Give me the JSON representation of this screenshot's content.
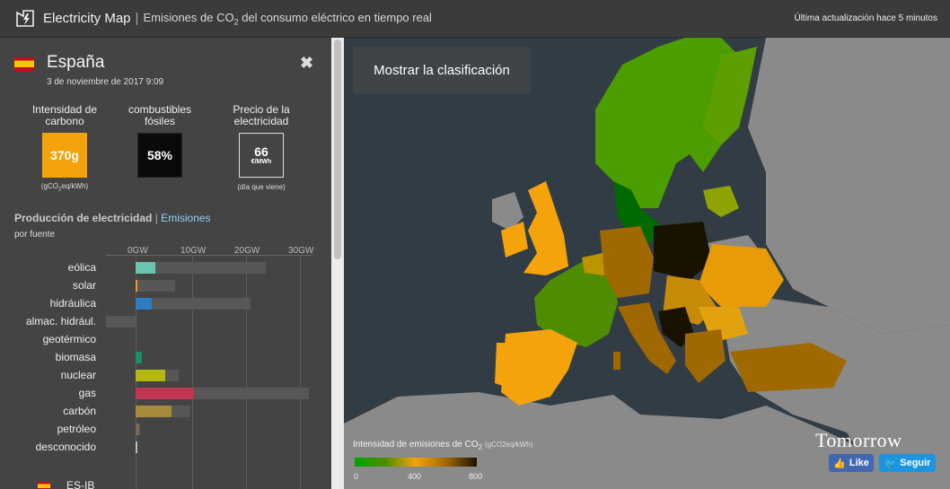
{
  "header": {
    "brand": "Electricity Map",
    "tagline_prefix": "Emisiones de CO",
    "tagline_sub": "2",
    "tagline_suffix": " del consumo eléctrico en tiempo real",
    "updated": "Última actualización hace 5 minutos"
  },
  "country": {
    "name": "España",
    "datetime": "3 de noviembre de 2017 9:09",
    "close_icon": "close-icon",
    "flag_icon": "spain-flag-icon"
  },
  "stats": {
    "carbon": {
      "label1": "Intensidad de",
      "label2": "carbono",
      "value": "370g",
      "unit": "(gCO2eq/kWh)",
      "color": "#f5a30b"
    },
    "fossil": {
      "label1": "combustibles",
      "label2": "fósiles",
      "value": "58%",
      "color": "#0a0a0a"
    },
    "price": {
      "label1": "Precio de la",
      "label2": "electricidad",
      "value": "66",
      "unit_small": "€/MWh",
      "note": "(día que viene)"
    }
  },
  "production": {
    "title": "Producción de electricidad",
    "separator": "|",
    "link": "Emisiones",
    "subtitle": "por fuente",
    "axis_ticks": [
      "0GW",
      "10GW",
      "20GW",
      "30GW"
    ],
    "rows": [
      {
        "label": "eólica",
        "production_gw": 3.7,
        "capacity_gw": 23.9,
        "color": "#6bc4b0"
      },
      {
        "label": "solar",
        "production_gw": 0.3,
        "capacity_gw": 7.2,
        "color": "#f59a1c"
      },
      {
        "label": "hidráulica",
        "production_gw": 3.0,
        "capacity_gw": 21.1,
        "color": "#2d7dc3"
      },
      {
        "label": "almac. hidrául.",
        "production_gw": 0,
        "capacity_gw": -5.5,
        "color": "#1f4e8c"
      },
      {
        "label": "geotérmico",
        "production_gw": 0,
        "capacity_gw": 0,
        "color": "#888888"
      },
      {
        "label": "biomasa",
        "production_gw": 1.1,
        "capacity_gw": 1.1,
        "color": "#1a8f6c"
      },
      {
        "label": "nuclear",
        "production_gw": 5.5,
        "capacity_gw": 7.9,
        "color": "#b5b80e"
      },
      {
        "label": "gas",
        "production_gw": 10.8,
        "capacity_gw": 31.9,
        "color": "#c0354f"
      },
      {
        "label": "carbón",
        "production_gw": 6.6,
        "capacity_gw": 10.1,
        "color": "#a88b3a"
      },
      {
        "label": "petróleo",
        "production_gw": 0.6,
        "capacity_gw": 0.9,
        "color": "#7a6a55"
      },
      {
        "label": "desconocido",
        "production_gw": 0.3,
        "capacity_gw": 0.4,
        "color": "#bbbbbb"
      }
    ]
  },
  "next_zone": {
    "label": "ES-IB",
    "flag_icon": "spain-flag-icon"
  },
  "map": {
    "ranking_button": "Mostrar la clasificación",
    "legend_title_prefix": "Intensidad de emisiones de CO",
    "legend_title_sub": "2",
    "legend_unit": "(gCO2eq/kWh)",
    "legend_ticks": [
      "0",
      "400",
      "800"
    ],
    "tomorrow": "Tomorrow",
    "fb_label": "Like",
    "tw_label": "Seguir"
  }
}
